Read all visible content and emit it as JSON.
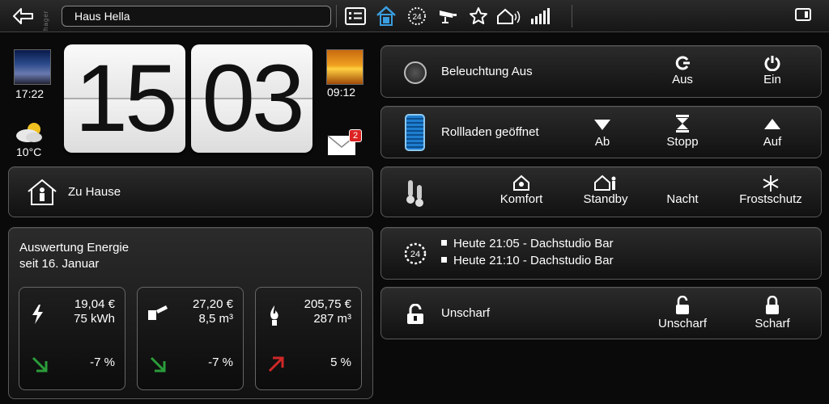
{
  "topbar": {
    "brand": "hager",
    "location": "Haus Hella",
    "icons": [
      "back-arrow-icon",
      "list-icon",
      "house-active-icon",
      "24h-icon",
      "camera-icon",
      "star-icon",
      "house-signal-icon",
      "signal-bars-icon",
      "window-icon"
    ],
    "accent": "#3a9ee0"
  },
  "clock": {
    "hours": "15",
    "minutes": "03",
    "sunset_time": "17:22",
    "sunrise_time": "09:12",
    "temperature": "10°C",
    "mail_count": "2"
  },
  "home": {
    "label": "Zu Hause"
  },
  "energy": {
    "title": "Auswertung Energie",
    "subtitle": "seit 16. Januar",
    "boxes": [
      {
        "icon": "lightning-icon",
        "cost": "19,04 €",
        "amount": "75 kWh",
        "change": "-7 %",
        "trend": "down",
        "trend_color": "#2a9d3a"
      },
      {
        "icon": "water-tap-icon",
        "cost": "27,20 €",
        "amount": "8,5 m³",
        "change": "-7 %",
        "trend": "down",
        "trend_color": "#2a9d3a"
      },
      {
        "icon": "gas-flame-icon",
        "cost": "205,75 €",
        "amount": "287 m³",
        "change": "5 %",
        "trend": "up",
        "trend_color": "#d02828"
      }
    ]
  },
  "lighting": {
    "label": "Beleuchtung Aus",
    "off_label": "Aus",
    "on_label": "Ein"
  },
  "shutters": {
    "label": "Rollladen geöffnet",
    "down_label": "Ab",
    "stop_label": "Stopp",
    "up_label": "Auf",
    "color": "#1e7ed0"
  },
  "heating": {
    "comfort_label": "Komfort",
    "standby_label": "Standby",
    "night_label": "Nacht",
    "frost_label": "Frostschutz"
  },
  "schedule": {
    "items": [
      "Heute 21:05 - Dachstudio Bar",
      "Heute 21:10 - Dachstudio Bar"
    ]
  },
  "alarm": {
    "label": "Unscharf",
    "disarm_label": "Unscharf",
    "arm_label": "Scharf"
  }
}
